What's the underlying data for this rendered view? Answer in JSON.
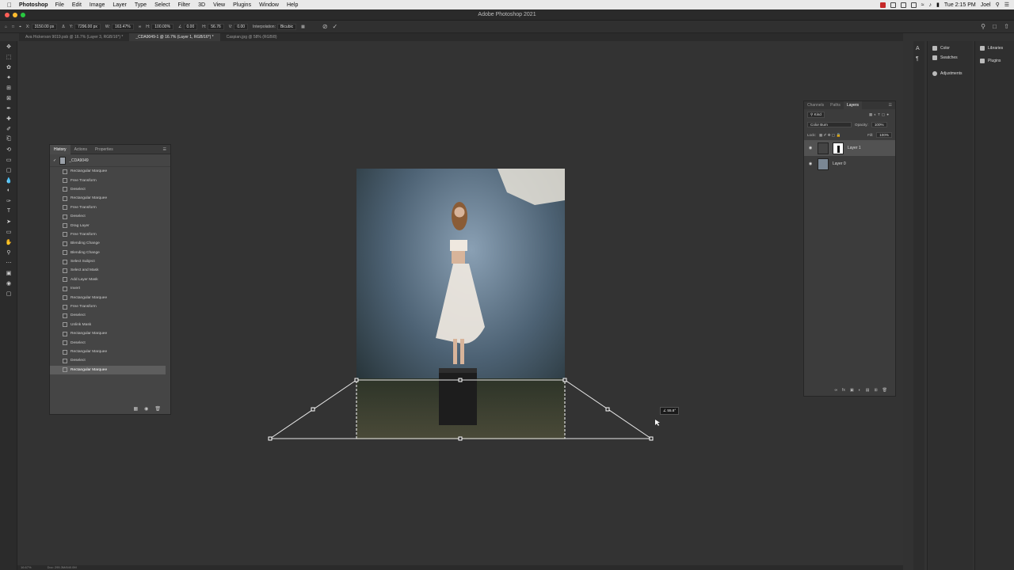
{
  "menubar": {
    "app_name": "Photoshop",
    "items": [
      "File",
      "Edit",
      "Image",
      "Layer",
      "Type",
      "Select",
      "Filter",
      "3D",
      "View",
      "Plugins",
      "Window",
      "Help"
    ],
    "clock": "Tue 2:15 PM",
    "user": "Joel"
  },
  "window": {
    "title": "Adobe Photoshop 2021"
  },
  "options": {
    "x_label": "X:",
    "x_value": "3150.00 px",
    "y_label": "Y:",
    "y_value": "7296.00 px",
    "w_label": "W:",
    "w_value": "163.47%",
    "h_label": "H:",
    "h_value": "100.00%",
    "angle_value": "0.00",
    "hskew_label": "H:",
    "hskew_value": "56.76",
    "vskew_label": "V:",
    "vskew_value": "0.00",
    "interp_label": "Interpolation:",
    "interp_value": "Bicubic"
  },
  "tabs": [
    {
      "label": "Ava Hickerson 9019.psb @ 16.7% (Layer 3, RGB/16*) *",
      "active": false
    },
    {
      "label": "_CDA9049-1 @ 16.7% (Layer 1, RGB/16*) *",
      "active": true
    },
    {
      "label": "Caspian.jpg @ 58% (RGB/8)",
      "active": false
    }
  ],
  "history": {
    "tabs": [
      "History",
      "Actions",
      "Properties"
    ],
    "snapshot": "_CDA9049",
    "items": [
      "Rectangular Marquee",
      "Free Transform",
      "Deselect",
      "Rectangular Marquee",
      "Free Transform",
      "Deselect",
      "Drag Layer",
      "Free Transform",
      "Blending Change",
      "Blending Change",
      "Select Subject",
      "Select and Mask",
      "Add Layer Mask",
      "Invert",
      "Rectangular Marquee",
      "Free Transform",
      "Deselect",
      "Unlink Mask",
      "Rectangular Marquee",
      "Deselect",
      "Rectangular Marquee",
      "Deselect",
      "Rectangular Marquee"
    ]
  },
  "layers": {
    "tabs": [
      "Channels",
      "Paths",
      "Layers"
    ],
    "kind": "Kind",
    "blend_mode": "Color Burn",
    "opacity_label": "Opacity:",
    "opacity": "100%",
    "lock_label": "Lock:",
    "fill_label": "Fill:",
    "fill": "100%",
    "items": [
      {
        "name": "Layer 1"
      },
      {
        "name": "Layer 0"
      }
    ]
  },
  "dock1": {
    "items": [
      "Color",
      "Swatches",
      "Adjustments"
    ]
  },
  "dock2": {
    "items": [
      "Libraries",
      "Plugins"
    ]
  },
  "status": {
    "zoom": "16.67%",
    "doc": "Doc: 295.3M/840.0M"
  },
  "transform_readout": "∠ 55.8°",
  "colors": {
    "canvas": "#333333",
    "panel": "#454545",
    "selection": "#5e5e5e"
  }
}
